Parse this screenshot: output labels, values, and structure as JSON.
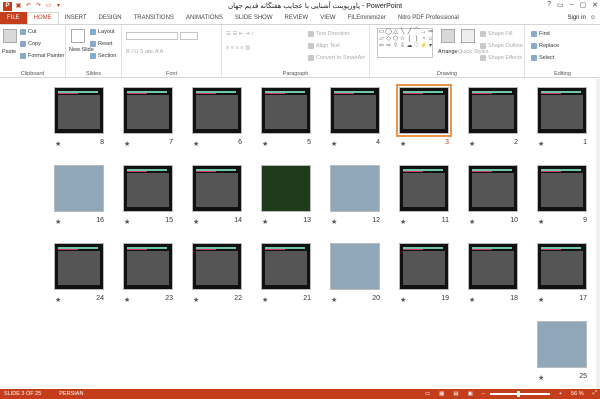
{
  "window": {
    "title": "پاورپوینت آشنایی با عجایب هفتگانه قدیم جهان - PowerPoint",
    "controls": [
      "?",
      "▭",
      "–",
      "▢",
      "✕"
    ]
  },
  "tabs": [
    "FILE",
    "HOME",
    "INSERT",
    "DESIGN",
    "TRANSITIONS",
    "ANIMATIONS",
    "SLIDE SHOW",
    "REVIEW",
    "VIEW",
    "FILEminimizer",
    "Nitro PDF Professional"
  ],
  "signin": "Sign in",
  "ribbon": {
    "clipboard": {
      "label": "Clipboard",
      "paste": "Paste",
      "cut": "Cut",
      "copy": "Copy",
      "format_painter": "Format Painter"
    },
    "slides": {
      "label": "Slides",
      "new_slide": "New Slide",
      "layout": "Layout",
      "reset": "Reset",
      "section": "Section"
    },
    "font": {
      "label": "Font"
    },
    "paragraph": {
      "label": "Paragraph",
      "text_direction": "Text Direction",
      "align_text": "Align Text",
      "convert": "Convert to SmartArt"
    },
    "drawing": {
      "label": "Drawing",
      "arrange": "Arrange",
      "quick_styles": "Quick Styles",
      "shape_fill": "Shape Fill",
      "shape_outline": "Shape Outline",
      "shape_effects": "Shape Effects"
    },
    "editing": {
      "label": "Editing",
      "find": "Find",
      "replace": "Replace",
      "select": "Select"
    }
  },
  "slides": [
    {
      "num": "1",
      "kind": "dark"
    },
    {
      "num": "2",
      "kind": "dark"
    },
    {
      "num": "3",
      "kind": "dark",
      "selected": true
    },
    {
      "num": "4",
      "kind": "dark"
    },
    {
      "num": "5",
      "kind": "dark"
    },
    {
      "num": "6",
      "kind": "dark"
    },
    {
      "num": "7",
      "kind": "dark"
    },
    {
      "num": "8",
      "kind": "dark"
    },
    {
      "num": "9",
      "kind": "dark"
    },
    {
      "num": "10",
      "kind": "dark"
    },
    {
      "num": "11",
      "kind": "dark"
    },
    {
      "num": "12",
      "kind": "photo"
    },
    {
      "num": "13",
      "kind": "photo-dark"
    },
    {
      "num": "14",
      "kind": "dark"
    },
    {
      "num": "15",
      "kind": "dark"
    },
    {
      "num": "16",
      "kind": "photo"
    },
    {
      "num": "17",
      "kind": "dark"
    },
    {
      "num": "18",
      "kind": "dark"
    },
    {
      "num": "19",
      "kind": "dark"
    },
    {
      "num": "20",
      "kind": "photo"
    },
    {
      "num": "21",
      "kind": "dark"
    },
    {
      "num": "22",
      "kind": "dark"
    },
    {
      "num": "23",
      "kind": "dark"
    },
    {
      "num": "24",
      "kind": "dark"
    },
    {
      "num": "25",
      "kind": "photo"
    }
  ],
  "status": {
    "slide_info": "SLIDE 3 OF 25",
    "language": "PERSIAN",
    "zoom": "56 %"
  },
  "colors": {
    "accent": "#c43e1c",
    "selection": "#e8934e"
  }
}
